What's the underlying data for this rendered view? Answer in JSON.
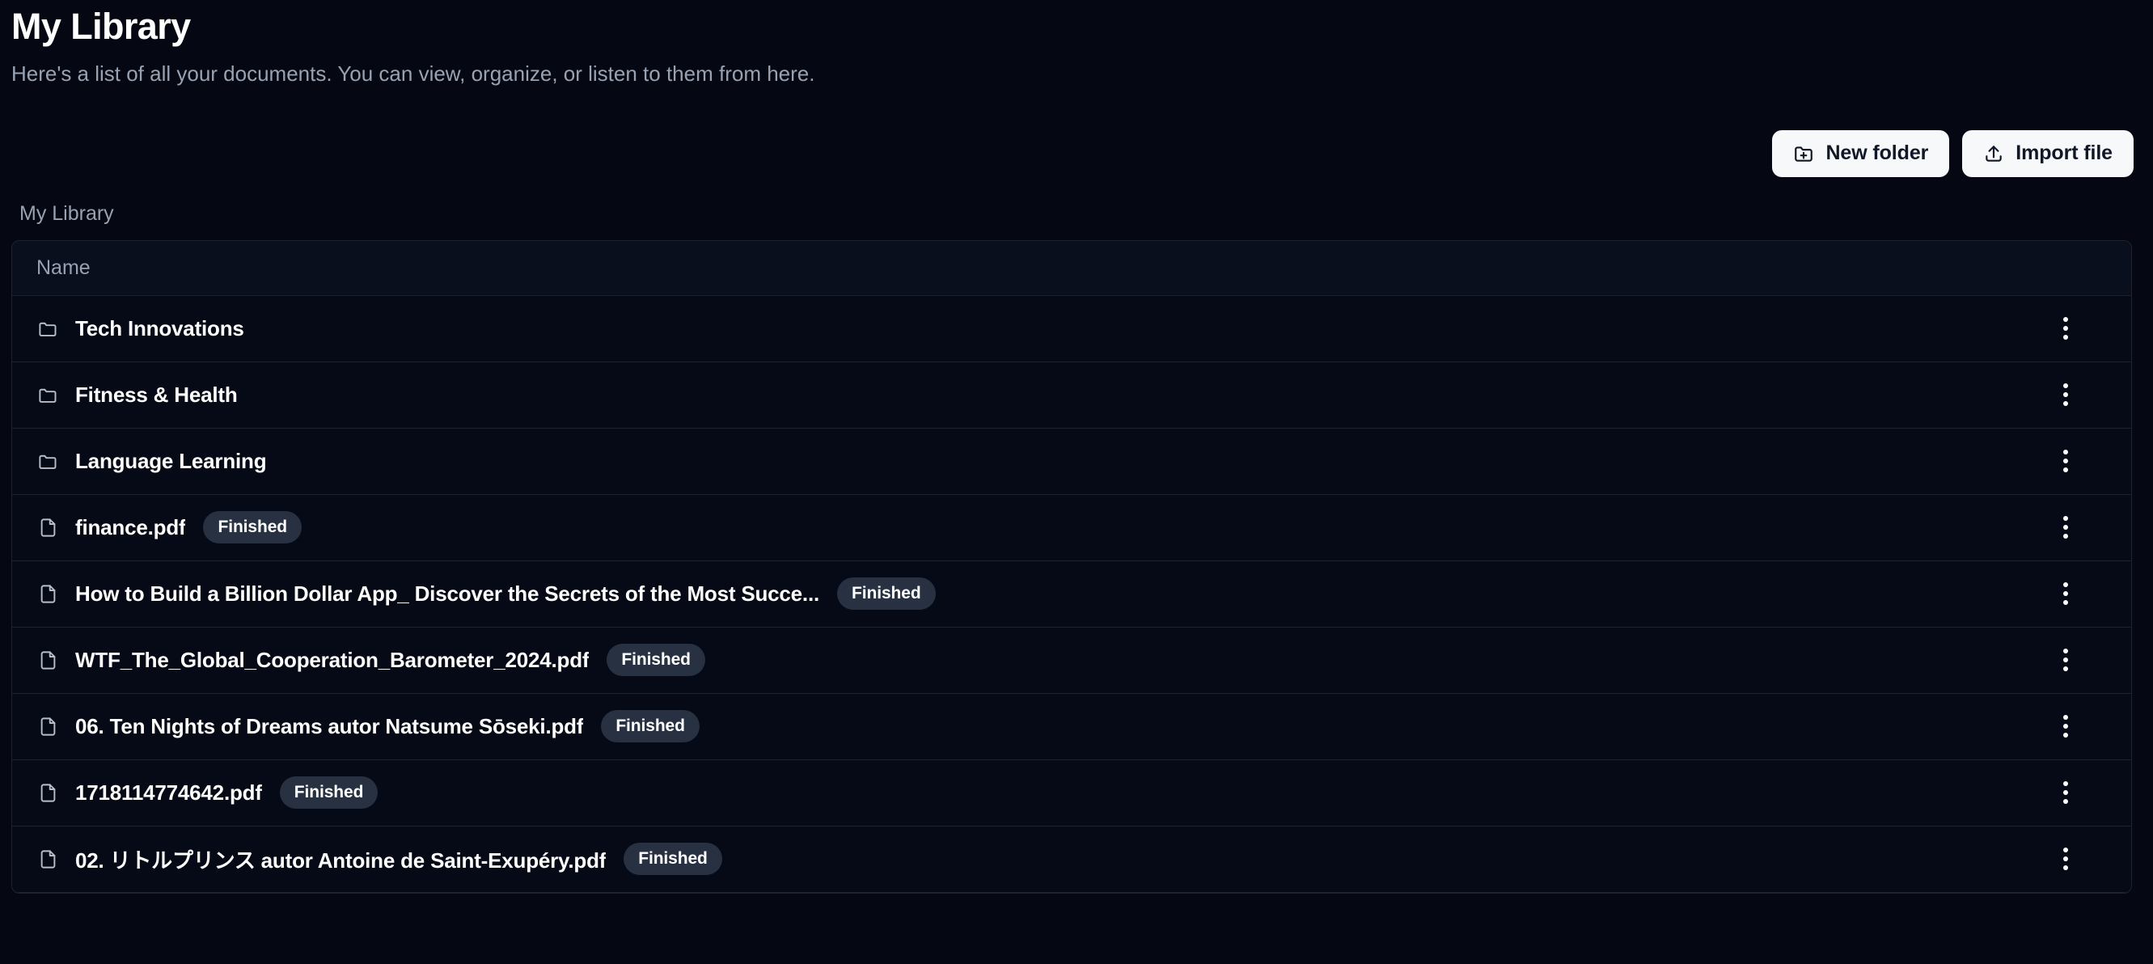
{
  "header": {
    "title": "My Library",
    "subtitle": "Here's a list of all your documents. You can view, organize, or listen to them from here."
  },
  "toolbar": {
    "new_folder_label": "New folder",
    "import_file_label": "Import file",
    "new_folder_icon": "folder-plus-icon",
    "import_file_icon": "upload-icon"
  },
  "breadcrumb": {
    "current": "My Library"
  },
  "table": {
    "columns": [
      "Name"
    ],
    "column_name": "Name",
    "row_menu_icon": "more-vertical-icon",
    "rows": [
      {
        "name": "Tech Innovations",
        "type": "folder",
        "icon": "folder-icon",
        "status": ""
      },
      {
        "name": "Fitness & Health",
        "type": "folder",
        "icon": "folder-icon",
        "status": ""
      },
      {
        "name": "Language Learning",
        "type": "folder",
        "icon": "folder-icon",
        "status": ""
      },
      {
        "name": "finance.pdf",
        "type": "file",
        "icon": "file-icon",
        "status": "Finished"
      },
      {
        "name": "How to Build a Billion Dollar App_ Discover the Secrets of the Most Succe...",
        "type": "file",
        "icon": "file-icon",
        "status": "Finished"
      },
      {
        "name": "WTF_The_Global_Cooperation_Barometer_2024.pdf",
        "type": "file",
        "icon": "file-icon",
        "status": "Finished"
      },
      {
        "name": "06. Ten Nights of Dreams autor Natsume Sōseki.pdf",
        "type": "file",
        "icon": "file-icon",
        "status": "Finished"
      },
      {
        "name": "1718114774642.pdf",
        "type": "file",
        "icon": "file-icon",
        "status": "Finished"
      },
      {
        "name": "02. リトルプリンス autor Antoine de Saint-Exupéry.pdf",
        "type": "file",
        "icon": "file-icon",
        "status": "Finished"
      }
    ]
  },
  "colors": {
    "background": "#050812",
    "surface": "#060a16",
    "border": "#1d2430",
    "text_primary": "#ffffff",
    "text_muted": "#98a2b3",
    "badge_bg": "#273142",
    "button_bg": "#f7f8fa",
    "button_text": "#101828"
  }
}
